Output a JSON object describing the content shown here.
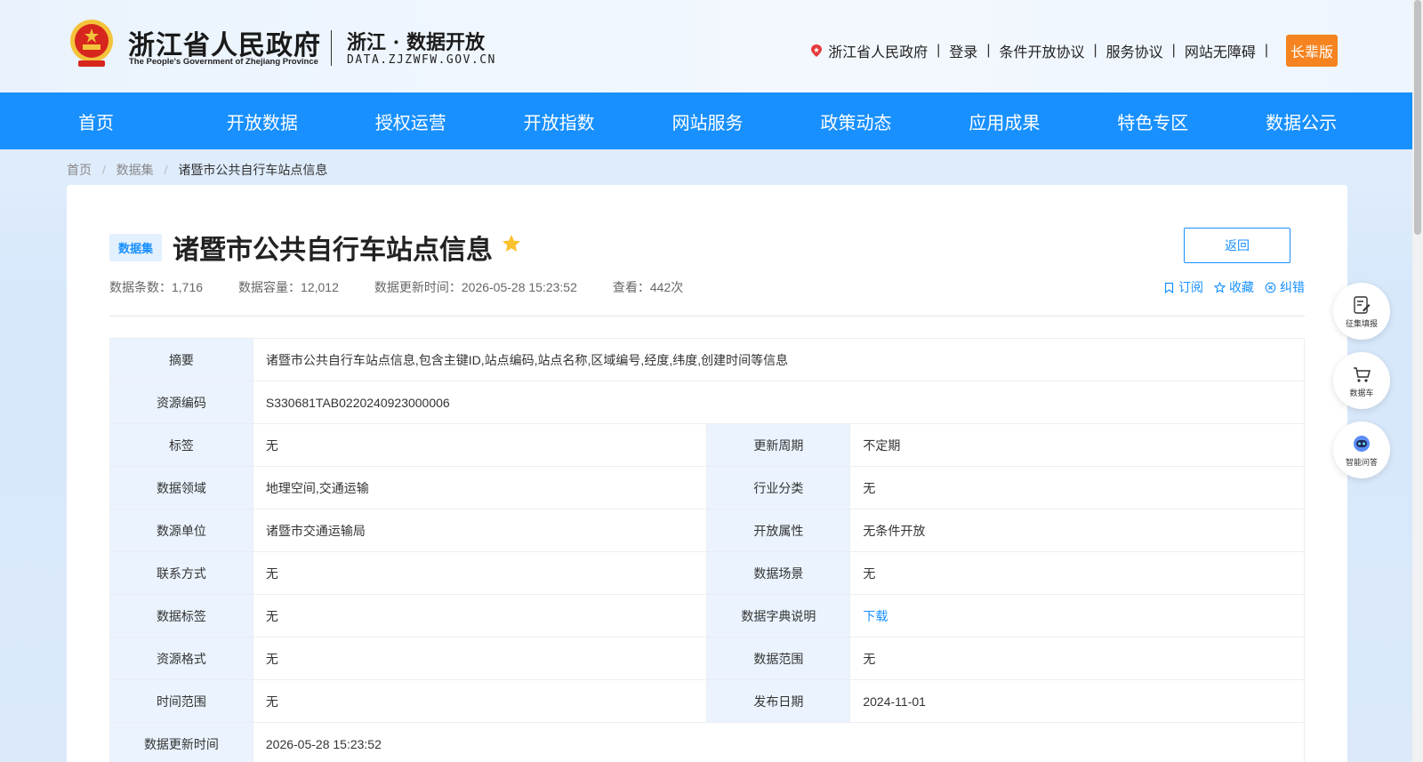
{
  "header": {
    "gov_name": "浙江省人民政府",
    "gov_en": "The People's Government of Zhejiang Province",
    "site_name": "浙江 · 数据开放",
    "site_domain": "DATA.ZJZWFW.GOV.CN",
    "links": {
      "region": "浙江省人民政府",
      "login": "登录",
      "conditional_agreement": "条件开放协议",
      "service_agreement": "服务协议",
      "accessibility": "网站无障碍",
      "elder": "长辈版"
    }
  },
  "nav": [
    "首页",
    "开放数据",
    "授权运营",
    "开放指数",
    "网站服务",
    "政策动态",
    "应用成果",
    "特色专区",
    "数据公示"
  ],
  "breadcrumb": [
    "首页",
    "数据集",
    "诸暨市公共自行车站点信息"
  ],
  "dataset": {
    "badge": "数据集",
    "title": "诸暨市公共自行车站点信息",
    "back_label": "返回",
    "meta": {
      "count": "数据条数：1,716",
      "capacity": "数据容量：12,012",
      "updated": "数据更新时间：2026-05-28 15:23:52",
      "views": "查看：442次"
    },
    "actions": {
      "subscribe": "订阅",
      "favorite": "收藏",
      "correct": "纠错"
    }
  },
  "info": {
    "summary_k": "摘要",
    "summary_v": "诸暨市公共自行车站点信息,包含主键ID,站点编码,站点名称,区域编号,经度,纬度,创建时间等信息",
    "code_k": "资源编码",
    "code_v": "S330681TAB0220240923000006",
    "rows": [
      {
        "k1": "标签",
        "v1": "无",
        "k2": "更新周期",
        "v2": "不定期"
      },
      {
        "k1": "数据领域",
        "v1": "地理空间,交通运输",
        "k2": "行业分类",
        "v2": "无"
      },
      {
        "k1": "数源单位",
        "v1": "诸暨市交通运输局",
        "k2": "开放属性",
        "v2": "无条件开放"
      },
      {
        "k1": "联系方式",
        "v1": "无",
        "k2": "数据场景",
        "v2": "无"
      },
      {
        "k1": "数据标签",
        "v1": "无",
        "k2": "数据字典说明",
        "v2": "下载"
      },
      {
        "k1": "资源格式",
        "v1": "无",
        "k2": "数据范围",
        "v2": "无"
      },
      {
        "k1": "时间范围",
        "v1": "无",
        "k2": "发布日期",
        "v2": "2024-11-01"
      }
    ],
    "last_k": "数据更新时间",
    "last_v": "2026-05-28 15:23:52"
  },
  "float_buttons": {
    "collect": "征集填报",
    "cart": "数据车",
    "qa": "智能问答"
  },
  "colors": {
    "primary": "#1890ff",
    "elder": "#f5831f",
    "star": "#fbc02d"
  }
}
